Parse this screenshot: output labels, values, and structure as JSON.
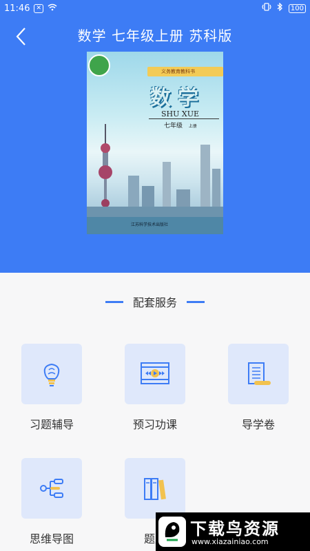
{
  "status_bar": {
    "time": "11:46",
    "left_icon_label": "✕",
    "battery": "100"
  },
  "header": {
    "title": "数学 七年级上册 苏科版",
    "back_icon": "chevron-left-icon"
  },
  "book_cover": {
    "series_band": "义务教育教科书",
    "subject": "数学",
    "pinyin": "SHU XUE",
    "grade": "七年级",
    "volume": "上册",
    "publisher": "江苏科学技术出版社"
  },
  "section": {
    "title": "配套服务"
  },
  "services": [
    {
      "label": "习题辅导",
      "icon": "lightbulb-brain-icon"
    },
    {
      "label": "预习功课",
      "icon": "video-player-icon"
    },
    {
      "label": "导学卷",
      "icon": "scroll-document-icon"
    },
    {
      "label": "思维导图",
      "icon": "mind-map-icon"
    },
    {
      "label": "题型",
      "icon": "books-icon"
    }
  ],
  "watermark": {
    "title": "下载鸟资源",
    "url": "www.xiazainiao.com"
  },
  "colors": {
    "primary": "#3d7cf5",
    "tile_bg": "#dfe8fb",
    "icon_blue": "#3d7cf5",
    "icon_yellow": "#f2c24f"
  }
}
